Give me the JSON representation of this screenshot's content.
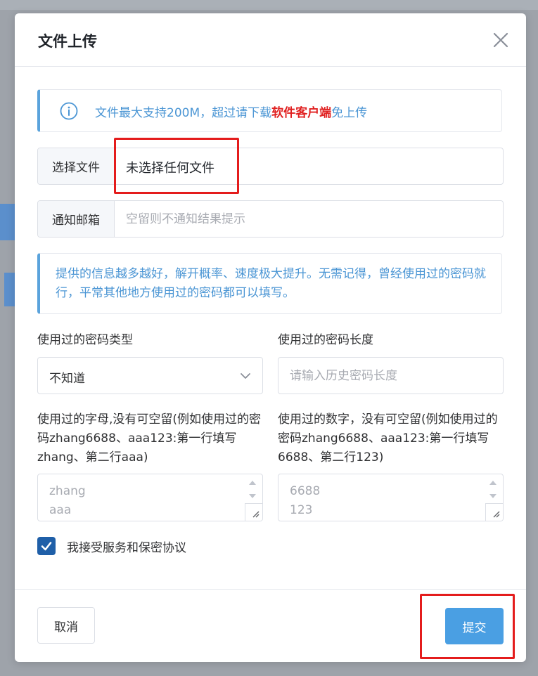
{
  "modal": {
    "title": "文件上传"
  },
  "notice": {
    "prefix": "文件最大支持200M，超过请下载",
    "highlight": "软件客户端",
    "suffix": "免上传"
  },
  "file_field": {
    "label": "选择文件",
    "value": "未选择任何文件"
  },
  "email_field": {
    "label": "通知邮箱",
    "placeholder": "空留则不通知结果提示"
  },
  "hint": {
    "text": "提供的信息越多越好，解开概率、速度极大提升。无需记得，曾经使用过的密码就行，平常其他地方使用过的密码都可以填写。"
  },
  "password_type": {
    "label": "使用过的密码类型",
    "selected": "不知道"
  },
  "password_length": {
    "label": "使用过的密码长度",
    "placeholder": "请输入历史密码长度"
  },
  "letters_field": {
    "label": "使用过的字母,没有可空留(例如使用过的密码zhang6688、aaa123:第一行填写zhang、第二行aaa)",
    "placeholder_lines": [
      "zhang",
      "aaa"
    ]
  },
  "digits_field": {
    "label": "使用过的数字，没有可空留(例如使用过的密码zhang6688、aaa123:第一行填写6688、第二行123)",
    "placeholder_lines": [
      "6688",
      "123"
    ]
  },
  "agreement": {
    "label": "我接受服务和保密协议",
    "checked": true
  },
  "footer": {
    "cancel_label": "取消",
    "submit_label": "提交"
  },
  "colors": {
    "accent": "#4a9fe3",
    "checkbox": "#1f5fa8",
    "highlight": "#e02020",
    "annotation": "#e41c1c"
  },
  "icons": {
    "close": "close-icon",
    "info": "info-icon",
    "dropdown": "chevron-down-icon",
    "check": "check-icon"
  }
}
